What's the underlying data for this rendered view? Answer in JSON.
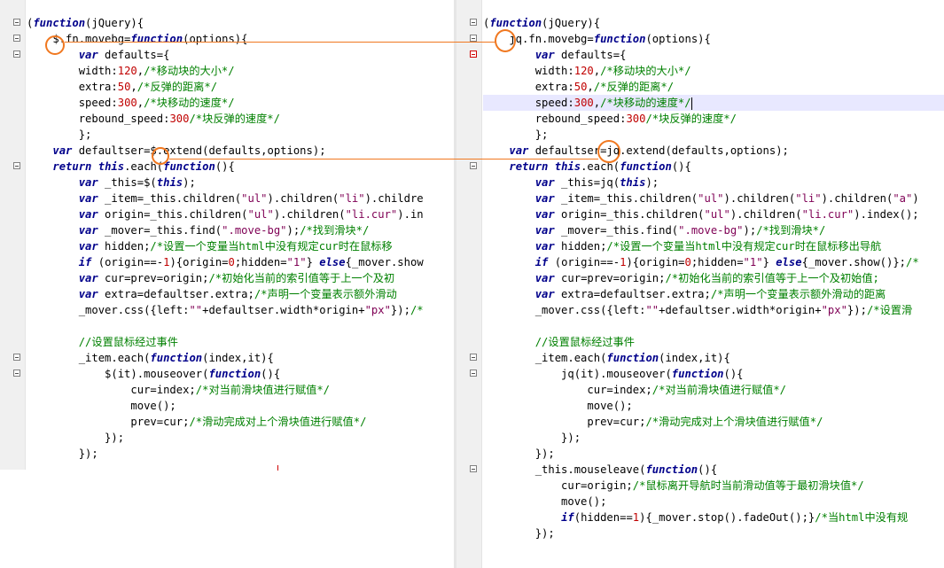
{
  "left_editor": {
    "lines": [
      {
        "text": "(function(jQuery){",
        "fold": true
      },
      {
        "text": "    $.fn.movebg=function(options){",
        "fold": true
      },
      {
        "text": "        var defaults={",
        "fold": true
      },
      {
        "text": "        width:120,/*移动块的大小*/",
        "fold": false
      },
      {
        "text": "        extra:50,/*反弹的距离*/",
        "fold": false
      },
      {
        "text": "        speed:300,/*块移动的速度*/",
        "fold": false
      },
      {
        "text": "        rebound_speed:300/*块反弹的速度*/",
        "fold": false
      },
      {
        "text": "        };",
        "fold": false
      },
      {
        "text": "    var defaultser=$.extend(defaults,options);",
        "fold": false
      },
      {
        "text": "    return this.each(function(){",
        "fold": true
      },
      {
        "text": "        var _this=$(this);",
        "fold": false
      },
      {
        "text": "        var _item=_this.children(\"ul\").children(\"li\").childre",
        "fold": false
      },
      {
        "text": "        var origin=_this.children(\"ul\").children(\"li.cur\").in",
        "fold": false
      },
      {
        "text": "        var _mover=_this.find(\".move-bg\");/*找到滑块*/",
        "fold": false
      },
      {
        "text": "        var hidden;/*设置一个变量当html中没有规定cur时在鼠标移",
        "fold": false
      },
      {
        "text": "        if (origin==-1){origin=0;hidden=\"1\"} else{_mover.show",
        "fold": false
      },
      {
        "text": "        var cur=prev=origin;/*初始化当前的索引值等于上一个及初",
        "fold": false
      },
      {
        "text": "        var extra=defaultser.extra;/*声明一个变量表示额外滑动",
        "fold": false
      },
      {
        "text": "        _mover.css({left:\"\"+defaultser.width*origin+\"px\"});/*",
        "fold": false
      },
      {
        "text": "",
        "fold": false
      },
      {
        "text": "        //设置鼠标经过事件",
        "fold": false
      },
      {
        "text": "        _item.each(function(index,it){",
        "fold": true
      },
      {
        "text": "            $(it).mouseover(function(){",
        "fold": true
      },
      {
        "text": "                cur=index;/*对当前滑块值进行赋值*/",
        "fold": false
      },
      {
        "text": "                move();",
        "fold": false
      },
      {
        "text": "                prev=cur;/*滑动完成对上个滑块值进行赋值*/",
        "fold": false
      },
      {
        "text": "            });",
        "fold": false
      },
      {
        "text": "        });",
        "fold": false
      }
    ]
  },
  "right_editor": {
    "lines": [
      {
        "text": "(function(jQuery){",
        "fold": true
      },
      {
        "text": "    jq.fn.movebg=function(options){",
        "fold": true
      },
      {
        "text": "        var defaults={",
        "fold": true
      },
      {
        "text": "        width:120,/*移动块的大小*/",
        "fold": false
      },
      {
        "text": "        extra:50,/*反弹的距离*/",
        "fold": false
      },
      {
        "text": "        speed:300,/*块移动的速度*/",
        "fold": false
      },
      {
        "text": "        rebound_speed:300/*块反弹的速度*/",
        "fold": false
      },
      {
        "text": "        };",
        "fold": false
      },
      {
        "text": "    var defaultser=jq.extend(defaults,options);",
        "fold": false
      },
      {
        "text": "    return this.each(function(){",
        "fold": true
      },
      {
        "text": "        var _this=jq(this);",
        "fold": false
      },
      {
        "text": "        var _item=_this.children(\"ul\").children(\"li\").children(\"a\")",
        "fold": false
      },
      {
        "text": "        var origin=_this.children(\"ul\").children(\"li.cur\").index();",
        "fold": false
      },
      {
        "text": "        var _mover=_this.find(\".move-bg\");/*找到滑块*/",
        "fold": false
      },
      {
        "text": "        var hidden;/*设置一个变量当html中没有规定cur时在鼠标移出导航",
        "fold": false
      },
      {
        "text": "        if (origin==-1){origin=0;hidden=\"1\"} else{_mover.show()};/*",
        "fold": false
      },
      {
        "text": "        var cur=prev=origin;/*初始化当前的索引值等于上一个及初始值;",
        "fold": false
      },
      {
        "text": "        var extra=defaultser.extra;/*声明一个变量表示额外滑动的距离",
        "fold": false
      },
      {
        "text": "        _mover.css({left:\"\"+defaultser.width*origin+\"px\"});/*设置滑",
        "fold": false
      },
      {
        "text": "",
        "fold": false
      },
      {
        "text": "        //设置鼠标经过事件",
        "fold": false
      },
      {
        "text": "        _item.each(function(index,it){",
        "fold": true
      },
      {
        "text": "            jq(it).mouseover(function(){",
        "fold": true
      },
      {
        "text": "                cur=index;/*对当前滑块值进行赋值*/",
        "fold": false
      },
      {
        "text": "                move();",
        "fold": false
      },
      {
        "text": "                prev=cur;/*滑动完成对上个滑块值进行赋值*/",
        "fold": false
      },
      {
        "text": "            });",
        "fold": false
      },
      {
        "text": "        });",
        "fold": false
      },
      {
        "text": "        _this.mouseleave(function(){",
        "fold": true
      },
      {
        "text": "            cur=origin;/*鼠标离开导航时当前滑动值等于最初滑块值*/",
        "fold": false
      },
      {
        "text": "            move();",
        "fold": false
      },
      {
        "text": "            if(hidden==1){_mover.stop().fadeOut();}/*当html中没有规",
        "fold": false
      },
      {
        "text": "        });",
        "fold": false
      }
    ]
  },
  "colors": {
    "annotation": "#f07820",
    "keyword": "#00008b",
    "number": "#c00000",
    "comment": "#008000",
    "highlight_line": "#e8e8ff"
  }
}
